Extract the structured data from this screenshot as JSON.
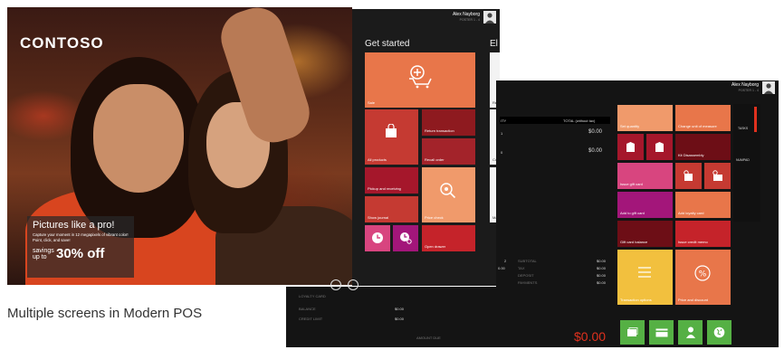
{
  "hero": {
    "brand": "CONTOSO",
    "promo_title": "Pictures like a pro!",
    "promo_desc": "Capture your moment in 12 megapixels of vibrant color! Point, click, and save!",
    "savings_label": "savings up to",
    "savings_value": "30% off"
  },
  "caption": "Multiple screens in Modern POS",
  "screen_back": {
    "user_name": "Alex Nayborg",
    "user_sub": "POSTER 1 - 4",
    "section_title": "Get started",
    "section_title_2": "El",
    "tiles": {
      "sale": "Sale",
      "all_products": "All products",
      "return_transaction": "Return transaction",
      "recall_order": "Recall order",
      "pickup": "Pickup and receiving",
      "price_check": "Price check",
      "show_journal": "Show journal",
      "open_drawer": "Open drawer"
    },
    "edge_labels": [
      "Re",
      "Co",
      "Ma"
    ]
  },
  "screen_front": {
    "user_name": "Alex Nayborg",
    "user_sub": "POSTER 1 - 4",
    "header_qty": "ITY",
    "header_total": "TOTAL (without tax)",
    "lines": [
      {
        "qty": "1",
        "total": "$0.00"
      },
      {
        "qty": "0",
        "total": "$0.00"
      }
    ],
    "summary_left": [
      {
        "label": "2",
        "value": "0.00"
      }
    ],
    "summary_right": [
      {
        "label": "SUBTOTAL",
        "value": "$0.00"
      },
      {
        "label": "TAX",
        "value": "$0.00"
      },
      {
        "label": "DEPOSIT",
        "value": "$0.00"
      },
      {
        "label": "PAYMENTS",
        "value": "$0.00"
      }
    ],
    "customer_fields": [
      {
        "label": "LOYALTY CARD",
        "value": ""
      },
      {
        "label": "BALANCE",
        "value": "$0.00"
      },
      {
        "label": "CREDIT LIMIT",
        "value": "$0.00"
      }
    ],
    "amount_due_label": "AMOUNT DUE",
    "amount_due": "$0.00",
    "tiles": {
      "set_quantity": "Set quantity",
      "change_uom": "Change unit of measure",
      "kit_disassembly": "Kit Disassembly",
      "issue_gift_card": "Issue gift card",
      "add_gift_card": "Add to gift card",
      "add_loyalty": "Add loyalty card",
      "gift_card_balance": "Gift card balance",
      "issue_credit_memo": "Issue credit memo",
      "transaction_options": "Transaction options",
      "price_discount": "Price and discount"
    },
    "side_tabs": [
      "TASKS",
      "NUMPAD"
    ]
  },
  "colors": {
    "orange": "#e8764a",
    "red": "#c53a32",
    "darkred": "#8e1a1f",
    "salmon": "#f09a6b",
    "pink": "#d8457f",
    "magenta": "#a3167a",
    "yellow": "#f2c03e",
    "green": "#55b044",
    "amount_red": "#e0311e"
  }
}
